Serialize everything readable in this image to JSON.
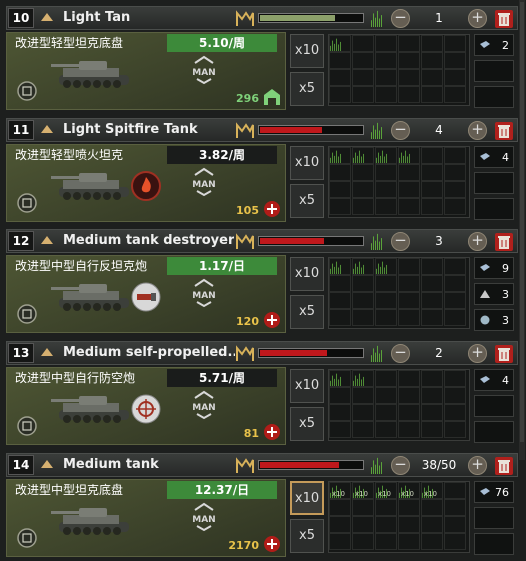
{
  "rows": [
    {
      "idx": "10",
      "name": "Light Tan",
      "equipment": "改进型轻型坦克底盘",
      "rate": "5.10/周",
      "count": "1",
      "progress": 0.72,
      "prog_color": "#8ca06a",
      "stock": "296",
      "stock_color": "#7fd17a",
      "stock_icon": "warehouse-icon",
      "req_icon": "",
      "chart_bars": 1,
      "x10_selected": false,
      "grid_charts": 1,
      "resources": [
        {
          "icon": "steel-icon",
          "value": "2"
        }
      ]
    },
    {
      "idx": "11",
      "name": "Light Spitfire Tank",
      "equipment": "改进型轻型喷火坦克",
      "rate": "3.82/周",
      "count": "4",
      "progress": 0.6,
      "prog_color": "#c0181c",
      "stock": "105",
      "stock_color": "#e8c24a",
      "stock_icon": "plus-icon",
      "req_icon": "flame-icon",
      "chart_bars": 4,
      "x10_selected": false,
      "grid_charts": 4,
      "resources": [
        {
          "icon": "steel-icon",
          "value": "4"
        }
      ]
    },
    {
      "idx": "12",
      "name": "Medium tank destroyer",
      "equipment": "改进型中型自行反坦克炮",
      "rate": "1.17/日",
      "count": "3",
      "progress": 0.62,
      "prog_color": "#c0181c",
      "stock": "120",
      "stock_color": "#e8c24a",
      "stock_icon": "plus-icon",
      "req_icon": "antitank-icon",
      "chart_bars": 3,
      "x10_selected": false,
      "grid_charts": 3,
      "resources": [
        {
          "icon": "steel-icon",
          "value": "9"
        },
        {
          "icon": "tungsten-icon",
          "value": "3"
        },
        {
          "icon": "chromium-icon",
          "value": "3"
        }
      ]
    },
    {
      "idx": "13",
      "name": "Medium self-propelled...",
      "equipment": "改进型中型自行防空炮",
      "rate": "5.71/周",
      "count": "2",
      "progress": 0.64,
      "prog_color": "#c0181c",
      "stock": "81",
      "stock_color": "#e8c24a",
      "stock_icon": "plus-icon",
      "req_icon": "antiair-icon",
      "chart_bars": 2,
      "x10_selected": false,
      "grid_charts": 2,
      "resources": [
        {
          "icon": "steel-icon",
          "value": "4"
        }
      ]
    },
    {
      "idx": "14",
      "name": "Medium tank",
      "equipment": "改进型中型坦克底盘",
      "rate": "12.37/日",
      "count": "38/50",
      "progress": 0.76,
      "prog_color": "#c0181c",
      "stock": "2170",
      "stock_color": "#e8c24a",
      "stock_icon": "plus-icon",
      "req_icon": "",
      "chart_bars": 5,
      "x10_selected": true,
      "grid_charts": 5,
      "resources": [
        {
          "icon": "steel-icon",
          "value": "76"
        }
      ]
    }
  ],
  "labels": {
    "x10": "x10",
    "x5": "x5",
    "man": "MAN",
    "grid_x10": "x10"
  },
  "colors": {
    "rate_green": "#3d8a3a",
    "rate_dark": "#1a1c1b",
    "chart_green": "#5aa33a"
  }
}
